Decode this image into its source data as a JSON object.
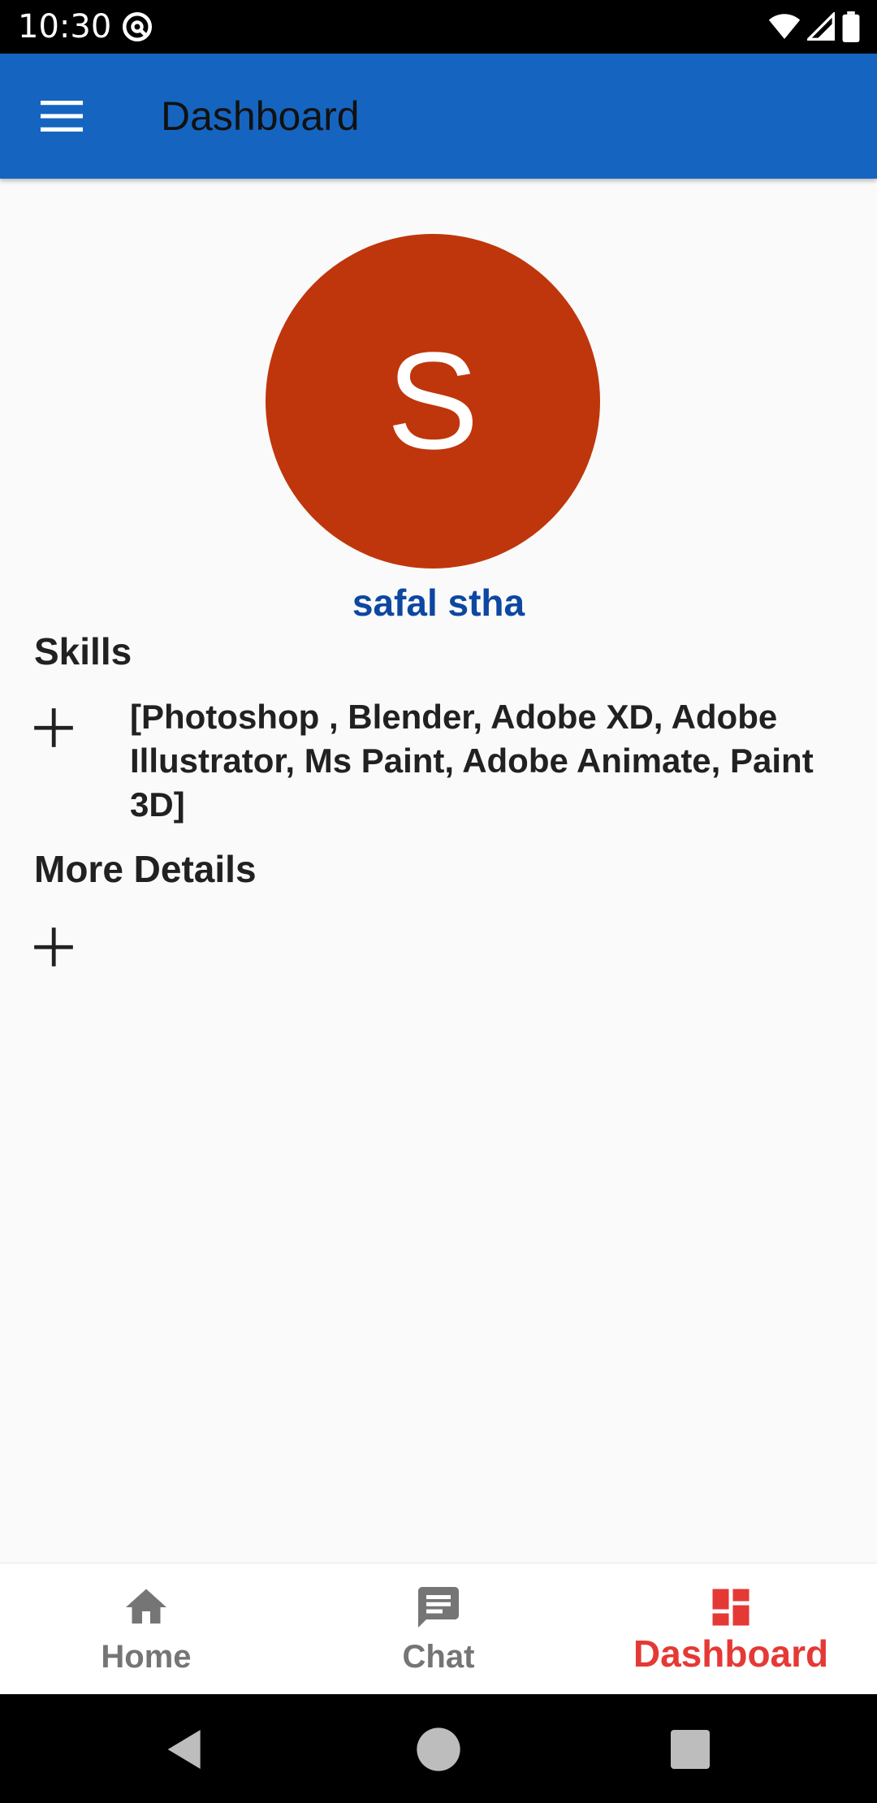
{
  "status_bar": {
    "time": "10:30",
    "icons": [
      "at-sign-icon",
      "wifi-icon",
      "signal-icon",
      "battery-icon"
    ]
  },
  "app_bar": {
    "title": "Dashboard",
    "menu_icon": "hamburger-menu-icon",
    "color": "#1565c0"
  },
  "profile": {
    "avatar_initial": "S",
    "avatar_color": "#bf360c",
    "name": "safal stha",
    "name_color": "#0d47a1"
  },
  "sections": {
    "skills": {
      "title": "Skills",
      "value": "[Photoshop , Blender, Adobe XD, Adobe Illustrator, Ms Paint, Adobe Animate, Paint 3D]",
      "add_icon": "plus-icon"
    },
    "more_details": {
      "title": "More Details",
      "add_icon": "plus-icon"
    }
  },
  "bottom_nav": {
    "items": [
      {
        "label": "Home",
        "icon": "home-icon",
        "active": false
      },
      {
        "label": "Chat",
        "icon": "chat-icon",
        "active": false
      },
      {
        "label": "Dashboard",
        "icon": "dashboard-icon",
        "active": true
      }
    ],
    "active_color": "#e53935",
    "inactive_color": "#757575"
  },
  "system_nav": {
    "buttons": [
      "back-icon",
      "home-circle-icon",
      "recents-icon"
    ]
  }
}
